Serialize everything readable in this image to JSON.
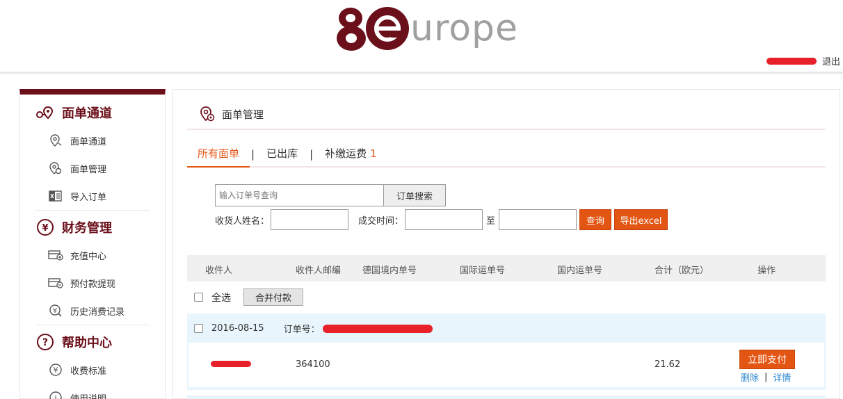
{
  "header": {
    "logo_text": "urope",
    "logout": "退出"
  },
  "sidebar": {
    "sections": [
      {
        "title": "面单通道",
        "icon": "route-icon",
        "items": [
          {
            "label": "面单通道",
            "icon": "location-pin-icon"
          },
          {
            "label": "面单管理",
            "icon": "location-gear-icon"
          },
          {
            "label": "导入订单",
            "icon": "excel-import-icon"
          }
        ]
      },
      {
        "title": "财务管理",
        "icon": "yen-circle-icon",
        "items": [
          {
            "label": "充值中心",
            "icon": "card-plus-icon"
          },
          {
            "label": "预付款提现",
            "icon": "card-minus-icon"
          },
          {
            "label": "历史消费记录",
            "icon": "yen-search-icon"
          }
        ]
      },
      {
        "title": "帮助中心",
        "icon": "question-circle-icon",
        "items": [
          {
            "label": "收费标准",
            "icon": "yen-circle-icon"
          },
          {
            "label": "使用说明",
            "icon": "info-circle-icon"
          }
        ]
      }
    ]
  },
  "main": {
    "title": "面单管理",
    "tabs": [
      {
        "label": "所有面单",
        "active": true
      },
      {
        "label": "已出库",
        "active": false
      },
      {
        "label": "补缴运费",
        "count": "1",
        "active": false
      }
    ],
    "tab_separator": "|",
    "search": {
      "placeholder": "输入订单号查询",
      "button": "订单搜索"
    },
    "filters": {
      "receiver_label": "收货人姓名：",
      "time_label": "成交时间：",
      "to_label": "至",
      "query_button": "查询",
      "export_button": "导出excel"
    },
    "table_headers": [
      "收件人",
      "收件人邮编",
      "德国境内单号",
      "国际运单号",
      "国内运单号",
      "合计（欧元）",
      "操作"
    ],
    "select_all": "全选",
    "merge_pay": "合并付款",
    "orders": [
      {
        "date": "2016-08-15",
        "order_label": "订单号：",
        "zip": "364100",
        "total": "21.62",
        "pay_button": "立即支付",
        "delete_link": "删除",
        "details_link": "详情",
        "link_separator": "|"
      }
    ]
  },
  "colors": {
    "brand": "#6b0f1a",
    "accent": "#e35513",
    "link": "#2a86d1",
    "order_bg": "#e8f5fc"
  }
}
